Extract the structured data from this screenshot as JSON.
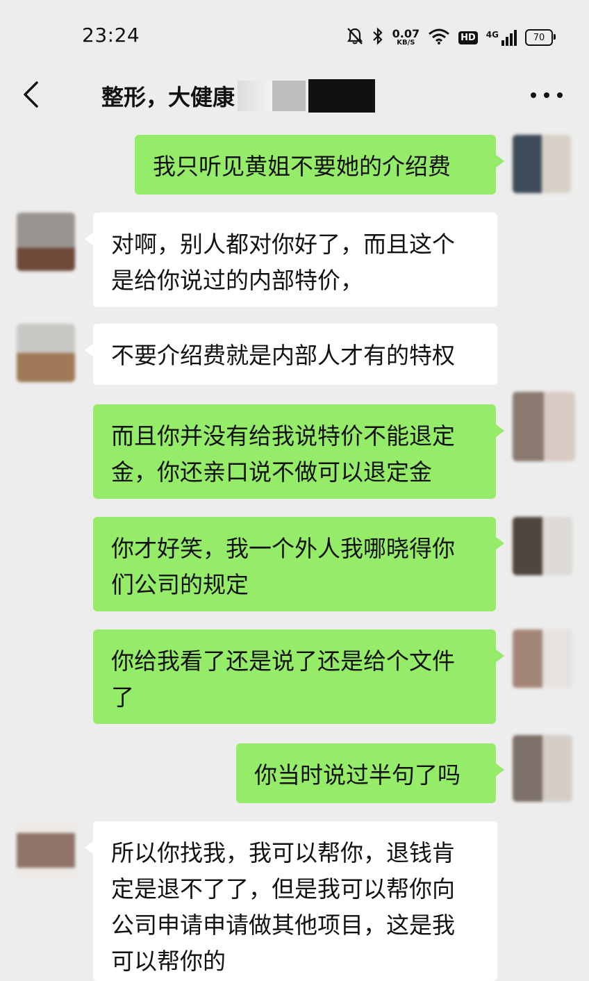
{
  "status": {
    "time": "23:24",
    "net_speed_value": "0.07",
    "net_speed_unit": "KB/S",
    "hd": "HD",
    "network": "4G",
    "battery": "70"
  },
  "header": {
    "title": "整形，大健康"
  },
  "messages": [
    {
      "sender": "me",
      "text": "我只听见黄姐不要她的介绍费"
    },
    {
      "sender": "them",
      "text": "对啊，别人都对你好了，而且这个\n是给你说过的内部特价，"
    },
    {
      "sender": "them",
      "text": "不要介绍费就是内部人才有的特权"
    },
    {
      "sender": "me",
      "text": "而且你并没有给我说特价不能退定\n金，你还亲口说不做可以退定金"
    },
    {
      "sender": "me",
      "text": "你才好笑，我一个外人我哪晓得你\n们公司的规定"
    },
    {
      "sender": "me",
      "text": "你给我看了还是说了还是给个文件\n了"
    },
    {
      "sender": "me",
      "text": "你当时说过半句了吗"
    },
    {
      "sender": "them",
      "text": "所以你找我，我可以帮你，退钱肯\n定是退不了了，但是我可以帮你向\n公司申请申请做其他项目，这是我\n可以帮你的"
    }
  ],
  "colors": {
    "background": "#ededed",
    "my_bubble": "#95ec69",
    "their_bubble": "#ffffff"
  },
  "icons": [
    "mute-icon",
    "bluetooth-icon",
    "wifi-icon",
    "signal-icon",
    "battery-icon",
    "back-icon",
    "more-icon"
  ]
}
